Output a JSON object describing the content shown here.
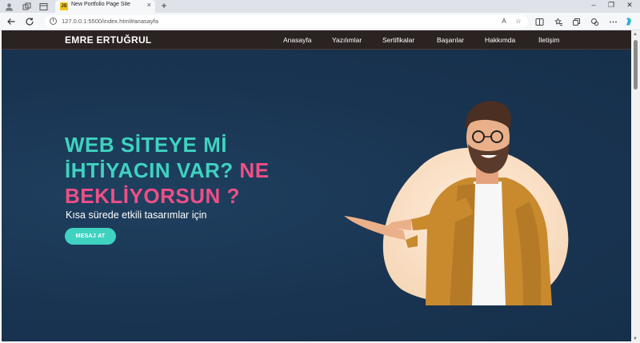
{
  "browser": {
    "tab": {
      "title": "New Portfolio Page Site",
      "favicon": "JS"
    },
    "address": {
      "url": "127.0.0.1:5500/index.html#anasayfa",
      "reader_label": "A"
    }
  },
  "site": {
    "logo": "EMRE ERTUĞRUL",
    "menu": [
      "Anasayfa",
      "Yazılımlar",
      "Sertifikalar",
      "Başarılar",
      "Hakkımda",
      "İletişim"
    ],
    "hero": {
      "line1": "WEB SİTEYE Mİ",
      "line2a": "İHTİYACIN VAR?",
      "line2b": "NE",
      "line3": "BEKLİYORSUN ?",
      "subtitle": "Kısa sürede etkili tasarımlar için",
      "cta": "MESAJ AT"
    },
    "colors": {
      "accent": "#3fd2c0",
      "highlight": "#ee4f86",
      "background": "#1a3652",
      "navbar": "#2b2222"
    }
  }
}
